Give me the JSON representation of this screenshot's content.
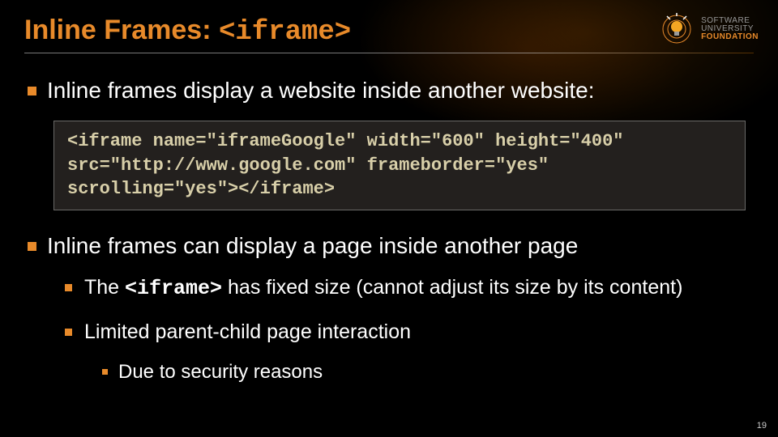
{
  "title": {
    "text": "Inline Frames: ",
    "code": "<iframe>"
  },
  "logo": {
    "line1": "SOFTWARE",
    "line2": "UNIVERSITY",
    "line3": "FOUNDATION"
  },
  "bullets": [
    {
      "text": "Inline frames display a website inside another website:"
    },
    {
      "text": "Inline frames can display a page inside another page",
      "children": [
        {
          "pre": "The ",
          "code": "<iframe>",
          "post": " has fixed size (cannot adjust its size by its content)"
        },
        {
          "text": "Limited parent-child page interaction",
          "children": [
            {
              "text": "Due to security reasons"
            }
          ]
        }
      ]
    }
  ],
  "code": {
    "line1": "<iframe name=\"iframeGoogle\" width=\"600\" height=\"400\"",
    "line2": "src=\"http://www.google.com\" frameborder=\"yes\"",
    "line3": "scrolling=\"yes\"></iframe>"
  },
  "page": "19",
  "colors": {
    "accent": "#e88a2a",
    "codebg": "#23201e",
    "codefg": "#d8cfa9"
  }
}
